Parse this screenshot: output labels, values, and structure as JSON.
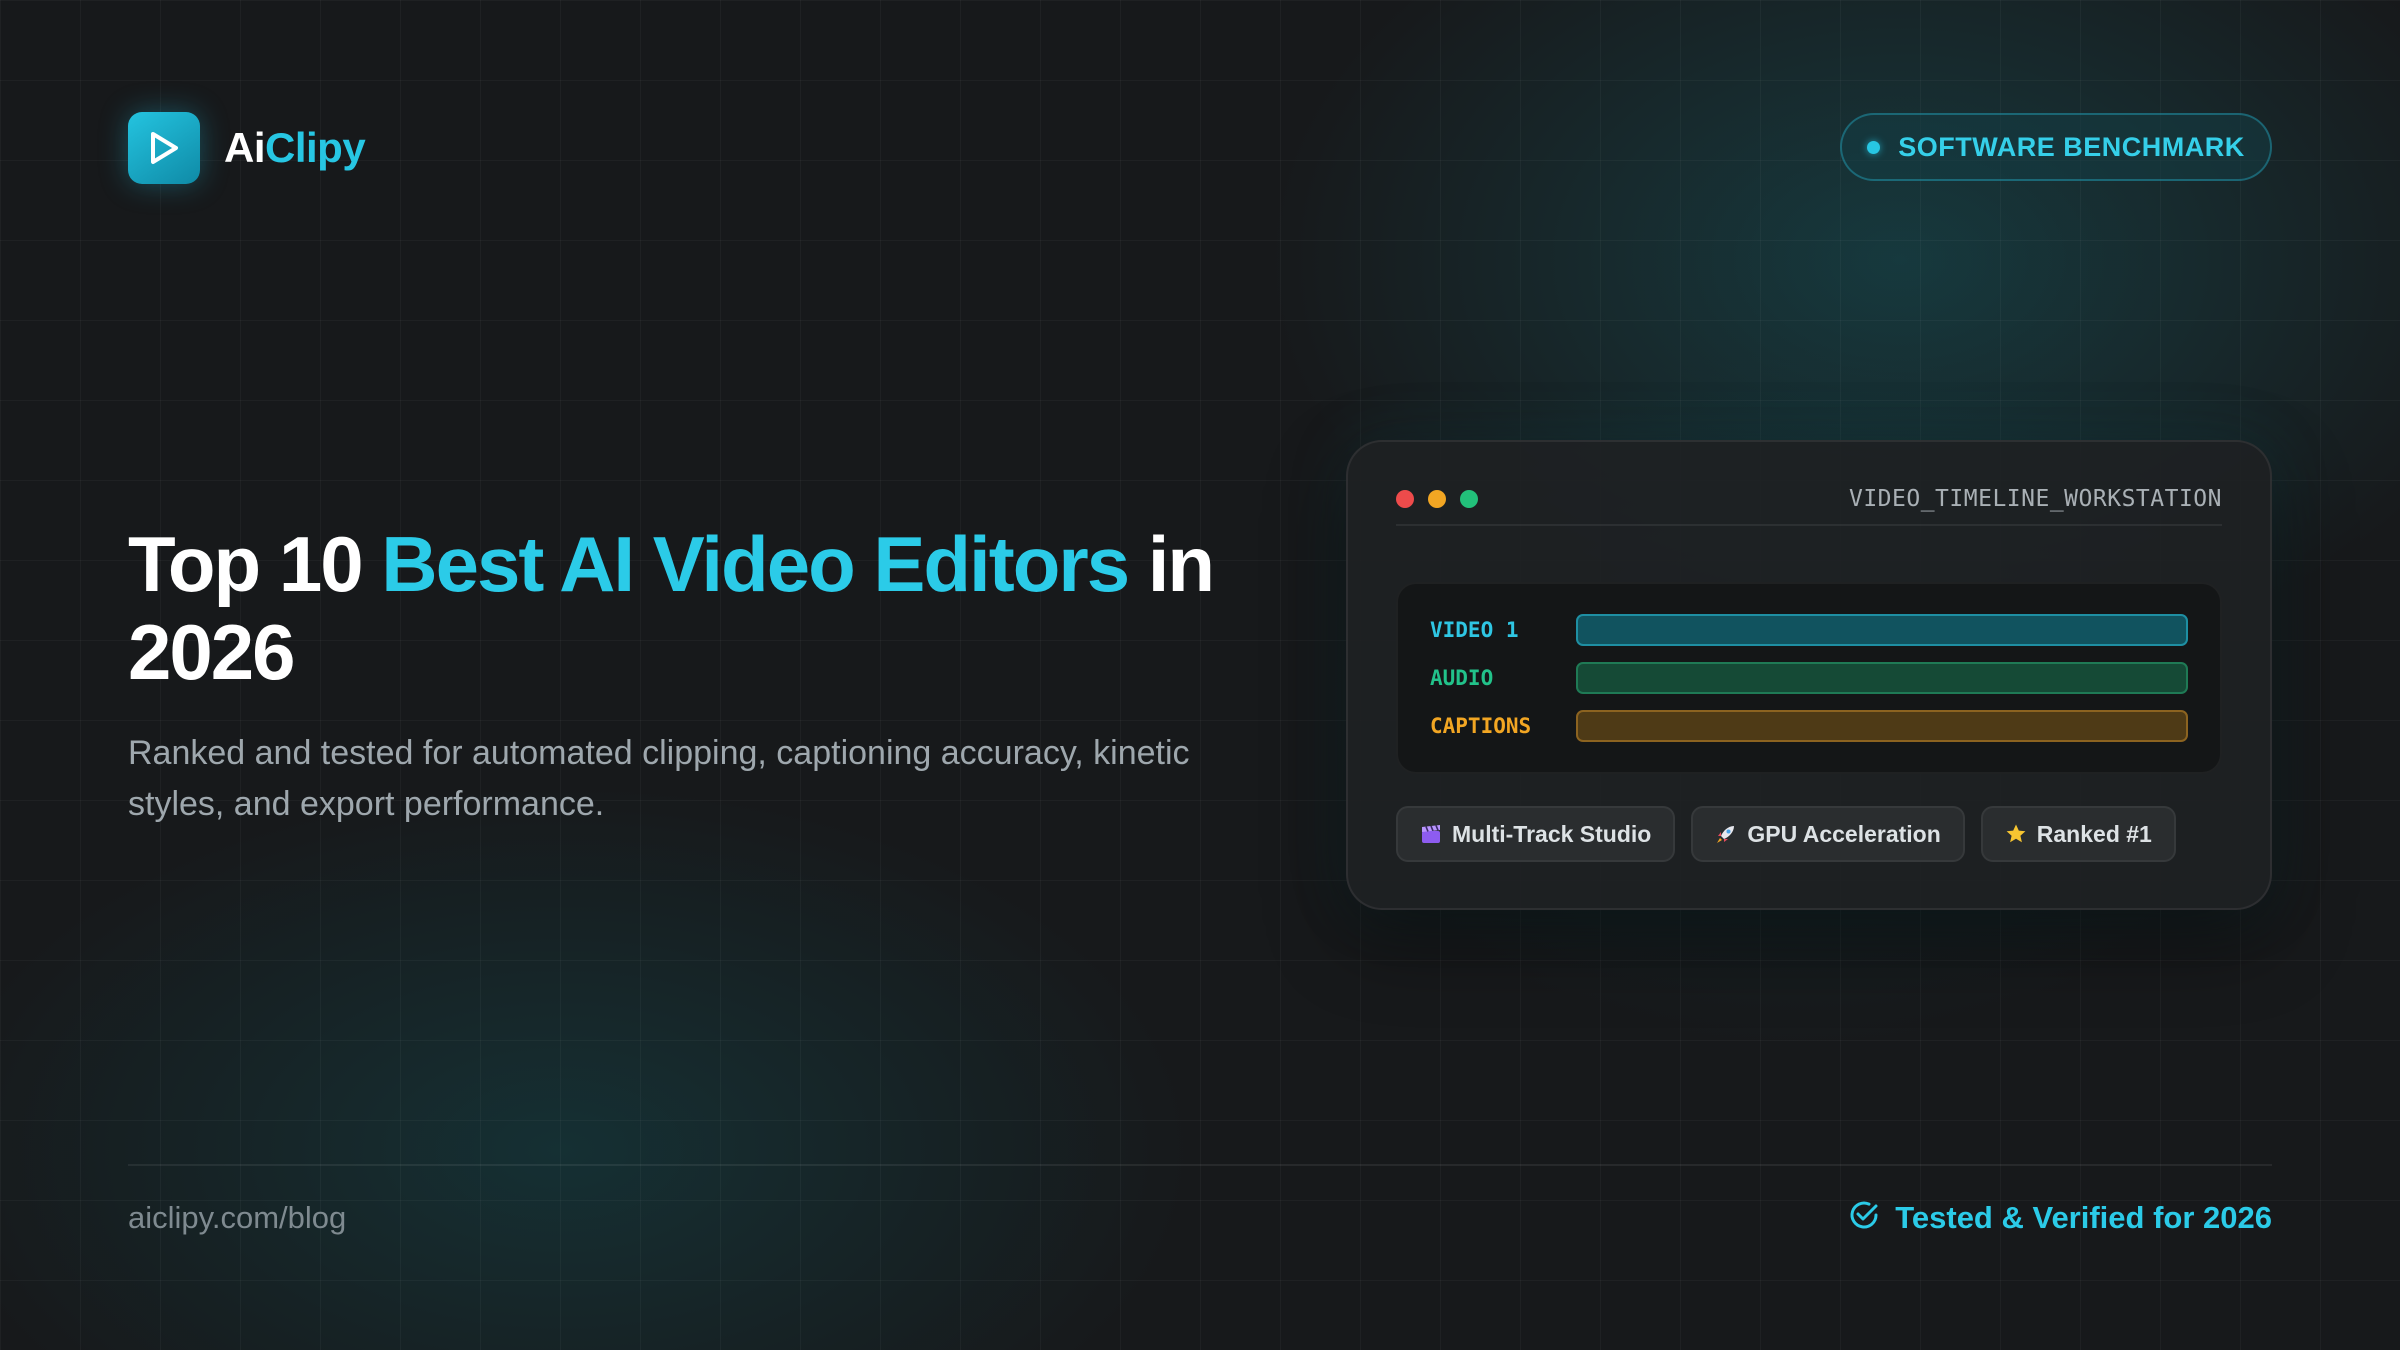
{
  "brand": {
    "name_part1": "Ai",
    "name_part2": "Clipy",
    "accent_color": "#27c6e3"
  },
  "badge": {
    "label": "SOFTWARE BENCHMARK"
  },
  "headline": {
    "prefix": "Top 10 ",
    "highlight": "Best AI Video Editors",
    "suffix": " in 2026"
  },
  "subtitle": "Ranked and tested for automated clipping, captioning accuracy, kinetic styles, and export performance.",
  "workstation": {
    "title": "VIDEO_TIMELINE_WORKSTATION",
    "window_dots": [
      "#ee4b4b",
      "#f2a623",
      "#22c07a"
    ],
    "tracks": [
      {
        "label": "VIDEO 1",
        "label_color": "#2fc6e3",
        "fill": "#11535f",
        "border": "#1e8fa3"
      },
      {
        "label": "AUDIO",
        "label_color": "#22c28a",
        "fill": "#154a36",
        "border": "#1f7a55"
      },
      {
        "label": "CAPTIONS",
        "label_color": "#f2a623",
        "fill": "#4e3a16",
        "border": "#8c6320"
      }
    ],
    "chips": [
      {
        "icon": "clapperboard-icon",
        "label": "Multi-Track Studio"
      },
      {
        "icon": "rocket-icon",
        "label": "GPU Acceleration"
      },
      {
        "icon": "star-icon",
        "label": "Ranked #1"
      }
    ]
  },
  "footer": {
    "url": "aiclipy.com/blog",
    "verified_label": "Tested & Verified for 2026"
  }
}
